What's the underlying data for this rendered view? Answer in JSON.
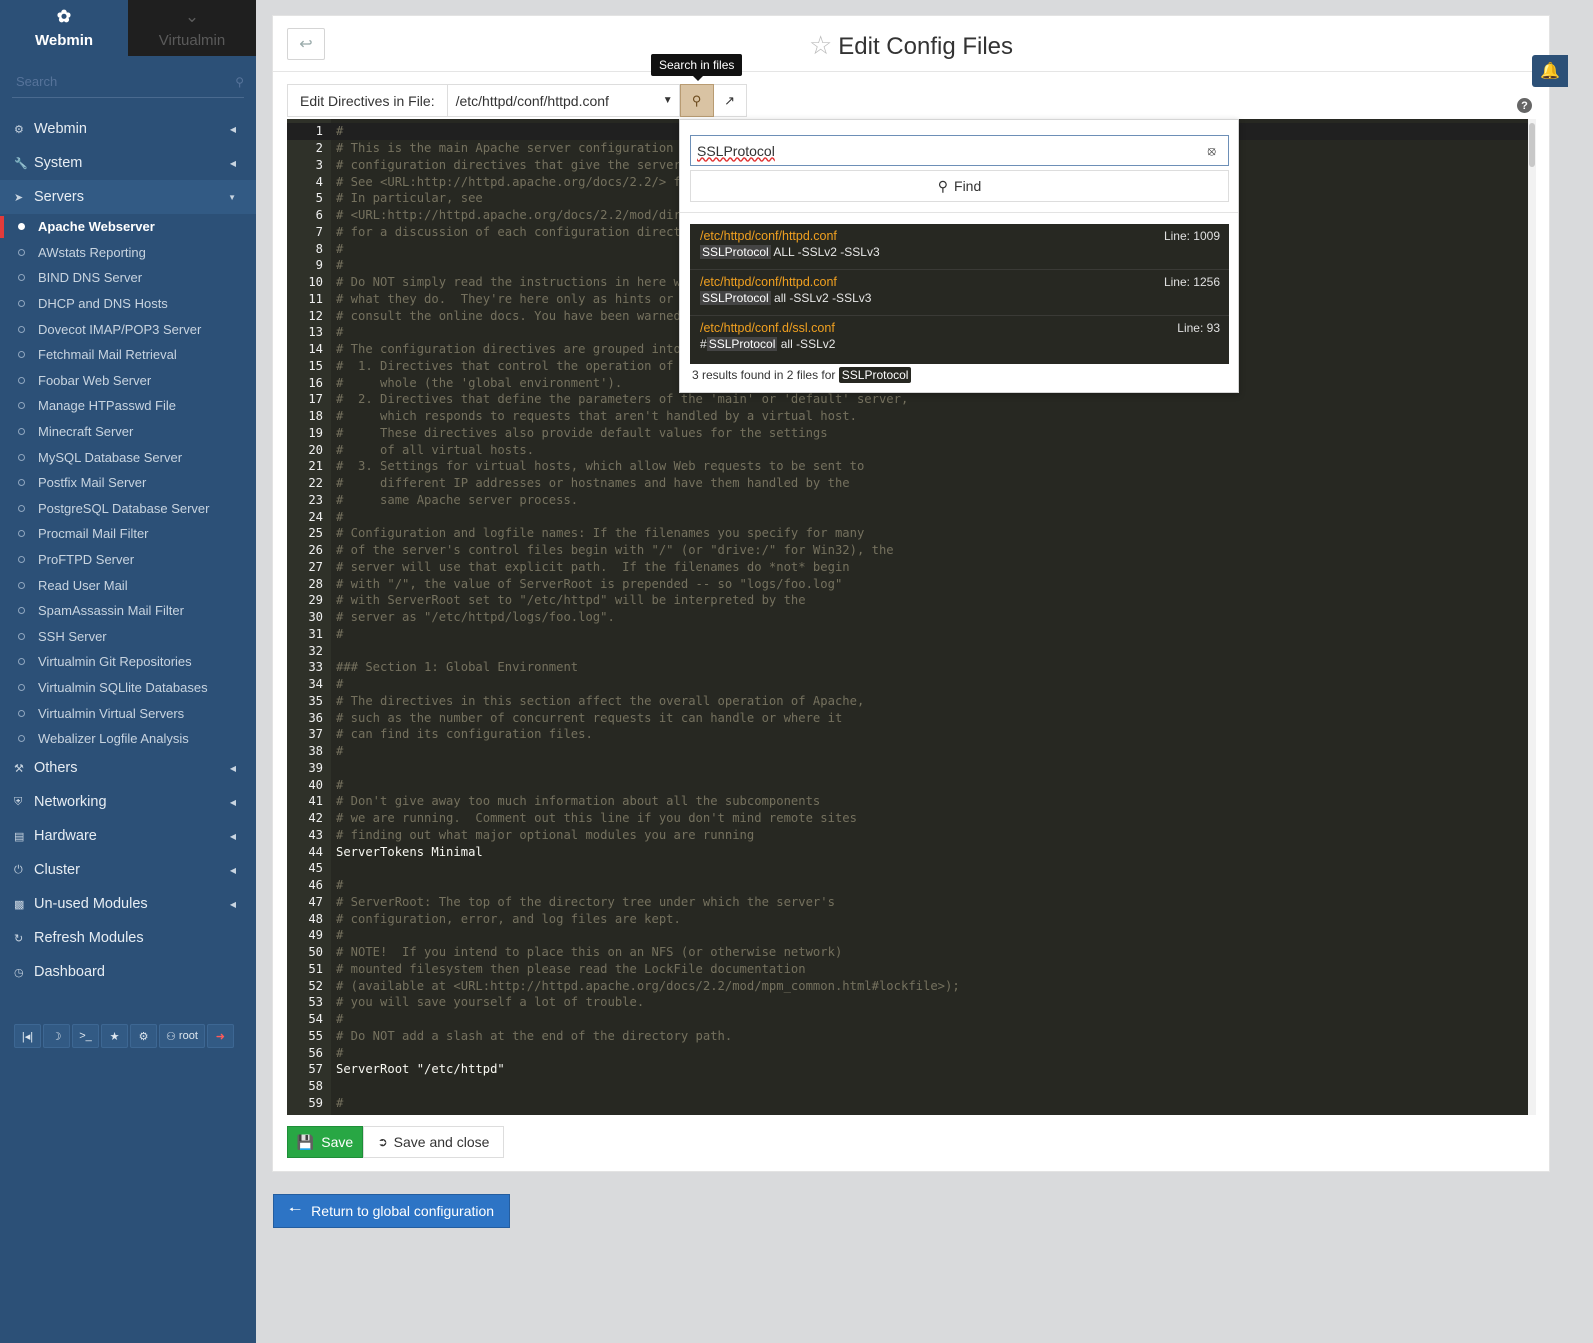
{
  "sidebar": {
    "tabs": [
      {
        "label": "Webmin",
        "icon": "webmin-logo-icon"
      },
      {
        "label": "Virtualmin",
        "icon": "chevron-down-icon"
      }
    ],
    "search_placeholder": "Search",
    "categories_top": [
      {
        "label": "Webmin",
        "icon": "gear-icon"
      },
      {
        "label": "System",
        "icon": "wrench-icon"
      },
      {
        "label": "Servers",
        "icon": "rocket-icon"
      }
    ],
    "server_modules": [
      "Apache Webserver",
      "AWstats Reporting",
      "BIND DNS Server",
      "DHCP and DNS Hosts",
      "Dovecot IMAP/POP3 Server",
      "Fetchmail Mail Retrieval",
      "Foobar Web Server",
      "Manage HTPasswd File",
      "Minecraft Server",
      "MySQL Database Server",
      "Postfix Mail Server",
      "PostgreSQL Database Server",
      "Procmail Mail Filter",
      "ProFTPD Server",
      "Read User Mail",
      "SpamAssassin Mail Filter",
      "SSH Server",
      "Virtualmin Git Repositories",
      "Virtualmin SQLlite Databases",
      "Virtualmin Virtual Servers",
      "Webalizer Logfile Analysis"
    ],
    "categories_bottom": [
      {
        "label": "Others",
        "icon": "hammer-icon"
      },
      {
        "label": "Networking",
        "icon": "shield-icon"
      },
      {
        "label": "Hardware",
        "icon": "hdd-icon"
      },
      {
        "label": "Cluster",
        "icon": "power-icon"
      },
      {
        "label": "Un-used Modules",
        "icon": "puzzle-icon"
      },
      {
        "label": "Refresh Modules",
        "icon": "refresh-icon"
      },
      {
        "label": "Dashboard",
        "icon": "dashboard-icon"
      }
    ],
    "user": "root"
  },
  "header": {
    "title": "Edit Config Files",
    "tooltip": "Search in files"
  },
  "file": {
    "label": "Edit Directives in File:",
    "selected": "/etc/httpd/conf/httpd.conf"
  },
  "search": {
    "query": "SSLProtocol",
    "find_label": "Find",
    "results": [
      {
        "path": "/etc/httpd/conf/httpd.conf",
        "line": "Line: 1009",
        "match": "SSLProtocol",
        "prefix": "",
        "rest": " ALL -SSLv2 -SSLv3"
      },
      {
        "path": "/etc/httpd/conf/httpd.conf",
        "line": "Line: 1256",
        "match": "SSLProtocol",
        "prefix": "",
        "rest": " all -SSLv2 -SSLv3"
      },
      {
        "path": "/etc/httpd/conf.d/ssl.conf",
        "line": "Line: 93",
        "match": "SSLProtocol",
        "prefix": "#",
        "rest": " all -SSLv2"
      }
    ],
    "summary_prefix": "3 results found in 2 files for",
    "summary_term": "SSLProtocol"
  },
  "editor": {
    "lines": [
      "#",
      "# This is the main Apache server configuration f",
      "# configuration directives that give the server i",
      "# See <URL:http://httpd.apache.org/docs/2.2/> fo",
      "# In particular, see",
      "# <URL:http://httpd.apache.org/docs/2.2/mod/dire",
      "# for a discussion of each configuration directiv",
      "#",
      "#",
      "# Do NOT simply read the instructions in here wit",
      "# what they do.  They're here only as hints or re",
      "# consult the online docs. You have been warned.",
      "#",
      "# The configuration directives are grouped into t",
      "#  1. Directives that control the operation of th",
      "#     whole (the 'global environment').",
      "#  2. Directives that define the parameters of the 'main' or 'default' server,",
      "#     which responds to requests that aren't handled by a virtual host.",
      "#     These directives also provide default values for the settings",
      "#     of all virtual hosts.",
      "#  3. Settings for virtual hosts, which allow Web requests to be sent to",
      "#     different IP addresses or hostnames and have them handled by the",
      "#     same Apache server process.",
      "#",
      "# Configuration and logfile names: If the filenames you specify for many",
      "# of the server's control files begin with \"/\" (or \"drive:/\" for Win32), the",
      "# server will use that explicit path.  If the filenames do *not* begin",
      "# with \"/\", the value of ServerRoot is prepended -- so \"logs/foo.log\"",
      "# with ServerRoot set to \"/etc/httpd\" will be interpreted by the",
      "# server as \"/etc/httpd/logs/foo.log\".",
      "#",
      "",
      "### Section 1: Global Environment",
      "#",
      "# The directives in this section affect the overall operation of Apache,",
      "# such as the number of concurrent requests it can handle or where it",
      "# can find its configuration files.",
      "#",
      "",
      "#",
      "# Don't give away too much information about all the subcomponents",
      "# we are running.  Comment out this line if you don't mind remote sites",
      "# finding out what major optional modules you are running",
      "ServerTokens Minimal",
      "",
      "#",
      "# ServerRoot: The top of the directory tree under which the server's",
      "# configuration, error, and log files are kept.",
      "#",
      "# NOTE!  If you intend to place this on an NFS (or otherwise network)",
      "# mounted filesystem then please read the LockFile documentation",
      "# (available at <URL:http://httpd.apache.org/docs/2.2/mod/mpm_common.html#lockfile>);",
      "# you will save yourself a lot of trouble.",
      "#",
      "# Do NOT add a slash at the end of the directory path.",
      "#",
      "ServerRoot \"/etc/httpd\"",
      "",
      "#"
    ]
  },
  "buttons": {
    "save": "Save",
    "save_close": "Save and close",
    "return": "Return to global configuration"
  }
}
